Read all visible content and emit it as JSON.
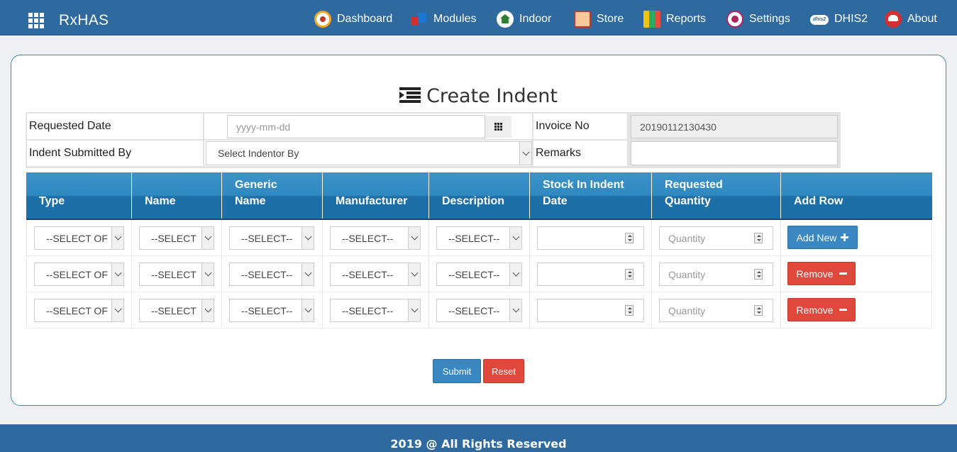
{
  "app": {
    "brand": "RxHAS"
  },
  "nav": [
    {
      "label": "Dashboard",
      "icon": "dashboard-icon"
    },
    {
      "label": "Modules",
      "icon": "modules-icon"
    },
    {
      "label": "Indoor",
      "icon": "indoor-icon"
    },
    {
      "label": "Store",
      "icon": "store-icon"
    },
    {
      "label": "Reports",
      "icon": "reports-icon"
    },
    {
      "label": "Settings",
      "icon": "settings-icon"
    },
    {
      "label": "DHIS2",
      "icon": "dhis2-icon",
      "icon_text": "dhis2"
    },
    {
      "label": "About",
      "icon": "about-icon"
    }
  ],
  "page": {
    "title": "Create Indent"
  },
  "form": {
    "requested_date_label": "Requested Date",
    "requested_date_placeholder": "yyyy-mm-dd",
    "invoice_no_label": "Invoice No",
    "invoice_no_value": "20190112130430",
    "submitted_by_label": "Indent Submitted By",
    "submitted_by_value": "Select Indentor By",
    "remarks_label": "Remarks",
    "remarks_value": ""
  },
  "table": {
    "headers": [
      "Type",
      "Name",
      "Generic\nName",
      "Manufacturer",
      "Description",
      "Stock In Indent\nDate",
      "Requested\nQuantity",
      "Add Row"
    ],
    "rows": [
      {
        "type": "--SELECT OF",
        "name": "--SELECT",
        "generic": "--SELECT--",
        "manufacturer": "--SELECT--",
        "description": "--SELECT--",
        "stock_date": "",
        "quantity_placeholder": "Quantity",
        "action": "Add New"
      },
      {
        "type": "--SELECT OF",
        "name": "--SELECT",
        "generic": "--SELECT--",
        "manufacturer": "--SELECT--",
        "description": "--SELECT--",
        "stock_date": "",
        "quantity_placeholder": "Quantity",
        "action": "Remove"
      },
      {
        "type": "--SELECT OF",
        "name": "--SELECT",
        "generic": "--SELECT--",
        "manufacturer": "--SELECT--",
        "description": "--SELECT--",
        "stock_date": "",
        "quantity_placeholder": "Quantity",
        "action": "Remove"
      }
    ]
  },
  "actions": {
    "submit": "Submit",
    "reset": "Reset"
  },
  "footer": {
    "text": "2019 @ All Rights Reserved"
  },
  "colors": {
    "primary": "#2e6aa0",
    "header_blue": "#2f89c0",
    "danger": "#e0483b",
    "button_blue": "#3a87c2"
  }
}
